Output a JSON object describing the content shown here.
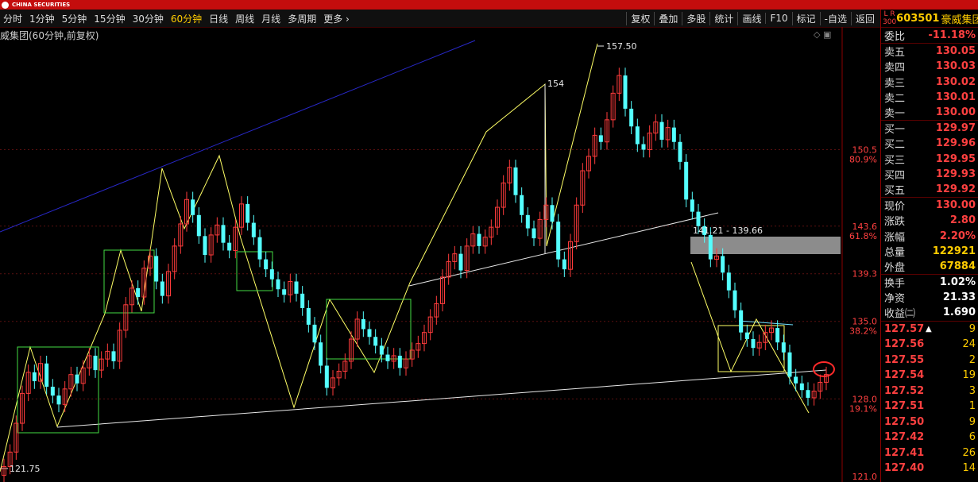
{
  "app": {
    "brand": "CHINA SECURITIES",
    "colors": {
      "up": "#ff3b3b",
      "down": "#54ffff",
      "brand": "#c40d0d",
      "accent": "#ffcc00"
    }
  },
  "toolbar": {
    "periods": [
      "分时",
      "1分钟",
      "5分钟",
      "15分钟",
      "30分钟",
      "60分钟",
      "日线",
      "周线",
      "月线",
      "多周期",
      "更多 ›"
    ],
    "active_period": "60分钟",
    "tools": [
      "复权",
      "叠加",
      "多股",
      "统计",
      "画线",
      "F10",
      "标记",
      "-自选",
      "返回"
    ]
  },
  "chart": {
    "title": "威集团(60分钟,前复权)",
    "annotations": {
      "high": "157.50",
      "mid_high": "154",
      "low": "121.75",
      "gap_label": "141.21 - 139.66"
    },
    "axis_labels": [
      {
        "price": "150.5",
        "pct": "80.9%"
      },
      {
        "price": "143.6",
        "pct": "61.8%"
      },
      {
        "price": "139.3",
        "pct": ""
      },
      {
        "price": "135.0",
        "pct": "38.2%"
      },
      {
        "price": "128.0",
        "pct": "19.1%"
      },
      {
        "price": "121.0",
        "pct": ""
      }
    ]
  },
  "chart_data": {
    "type": "candlestick",
    "y_unit": "price",
    "ylim": [
      121.0,
      160.0
    ],
    "fib_levels": [
      {
        "price": 150.5,
        "ratio": "80.9%"
      },
      {
        "price": 143.6,
        "ratio": "61.8%"
      },
      {
        "price": 139.3,
        "ratio": ""
      },
      {
        "price": 135.0,
        "ratio": "38.2%"
      },
      {
        "price": 128.0,
        "ratio": "19.1%"
      }
    ],
    "marked_prices": {
      "high": 157.5,
      "secondary_high": 154.0,
      "low": 121.75,
      "gap_top": 141.21,
      "gap_bottom": 139.66
    },
    "closes": [
      121.9,
      123.2,
      125.8,
      128.5,
      130.4,
      129.6,
      131.2,
      129.1,
      128.3,
      127.5,
      128.9,
      130.2,
      129.4,
      130.8,
      131.9,
      130.6,
      131.6,
      132.3,
      131.4,
      134.2,
      136.5,
      138.0,
      137.2,
      139.8,
      140.9,
      138.6,
      137.3,
      139.5,
      141.8,
      143.8,
      146.0,
      144.6,
      142.7,
      141.0,
      142.8,
      143.7,
      142.1,
      141.4,
      143.5,
      145.6,
      143.9,
      142.6,
      140.6,
      139.7,
      138.8,
      137.9,
      137.4,
      138.6,
      137.5,
      136.2,
      134.7,
      133.1,
      131.0,
      129.0,
      129.9,
      130.5,
      131.4,
      133.4,
      135.2,
      134.3,
      133.6,
      132.8,
      132.0,
      131.4,
      131.9,
      130.8,
      131.6,
      132.4,
      133.0,
      134.0,
      135.4,
      136.6,
      139.0,
      140.4,
      141.1,
      139.6,
      141.8,
      142.9,
      141.8,
      142.6,
      143.5,
      145.3,
      147.5,
      148.9,
      146.4,
      144.6,
      143.4,
      142.5,
      144.2,
      145.5,
      144.0,
      140.6,
      139.7,
      142.2,
      145.5,
      148.6,
      149.9,
      151.8,
      151.2,
      153.2,
      155.6,
      157.2,
      154.2,
      152.6,
      151.0,
      150.5,
      152.0,
      153.0,
      151.4,
      152.5,
      151.2,
      149.4,
      146.0,
      144.9,
      143.6,
      142.8,
      140.6,
      140.9,
      139.4,
      137.8,
      136.0,
      134.0,
      133.4,
      132.6,
      133.1,
      134.0,
      134.4,
      133.1,
      132.2,
      130.0,
      129.4,
      128.8,
      128.1,
      128.7,
      129.5,
      130.2
    ]
  },
  "quote": {
    "badge": "L R 300",
    "code": "603501",
    "name": "豪威集团",
    "top": {
      "label": "委比",
      "value": "-11.18%"
    },
    "asks": [
      {
        "label": "卖五",
        "price": "130.05"
      },
      {
        "label": "卖四",
        "price": "130.03"
      },
      {
        "label": "卖三",
        "price": "130.02"
      },
      {
        "label": "卖二",
        "price": "130.01"
      },
      {
        "label": "卖一",
        "price": "130.00"
      }
    ],
    "bids": [
      {
        "label": "买一",
        "price": "129.97"
      },
      {
        "label": "买二",
        "price": "129.96"
      },
      {
        "label": "买三",
        "price": "129.95"
      },
      {
        "label": "买四",
        "price": "129.93"
      },
      {
        "label": "买五",
        "price": "129.92"
      }
    ],
    "stats1": [
      {
        "label": "现价",
        "value": "130.00"
      },
      {
        "label": "涨跌",
        "value": "2.80"
      },
      {
        "label": "涨幅",
        "value": "2.20%"
      },
      {
        "label": "总量",
        "value": "122921"
      },
      {
        "label": "外盘",
        "value": "67884"
      }
    ],
    "stats2": [
      {
        "label": "换手",
        "value": "1.02%"
      },
      {
        "label": "净资",
        "value": "21.33"
      },
      {
        "label": "收益㈡",
        "value": "1.690"
      }
    ],
    "trades": [
      {
        "price": "127.57",
        "arrow": "▲",
        "vol": "9"
      },
      {
        "price": "127.56",
        "arrow": "",
        "vol": "24"
      },
      {
        "price": "127.55",
        "arrow": "",
        "vol": "2"
      },
      {
        "price": "127.54",
        "arrow": "",
        "vol": "19"
      },
      {
        "price": "127.52",
        "arrow": "",
        "vol": "3"
      },
      {
        "price": "127.51",
        "arrow": "",
        "vol": "1"
      },
      {
        "price": "127.50",
        "arrow": "",
        "vol": "9"
      },
      {
        "price": "127.42",
        "arrow": "",
        "vol": "6"
      },
      {
        "price": "127.41",
        "arrow": "",
        "vol": "26"
      },
      {
        "price": "127.40",
        "arrow": "",
        "vol": "14"
      }
    ]
  }
}
